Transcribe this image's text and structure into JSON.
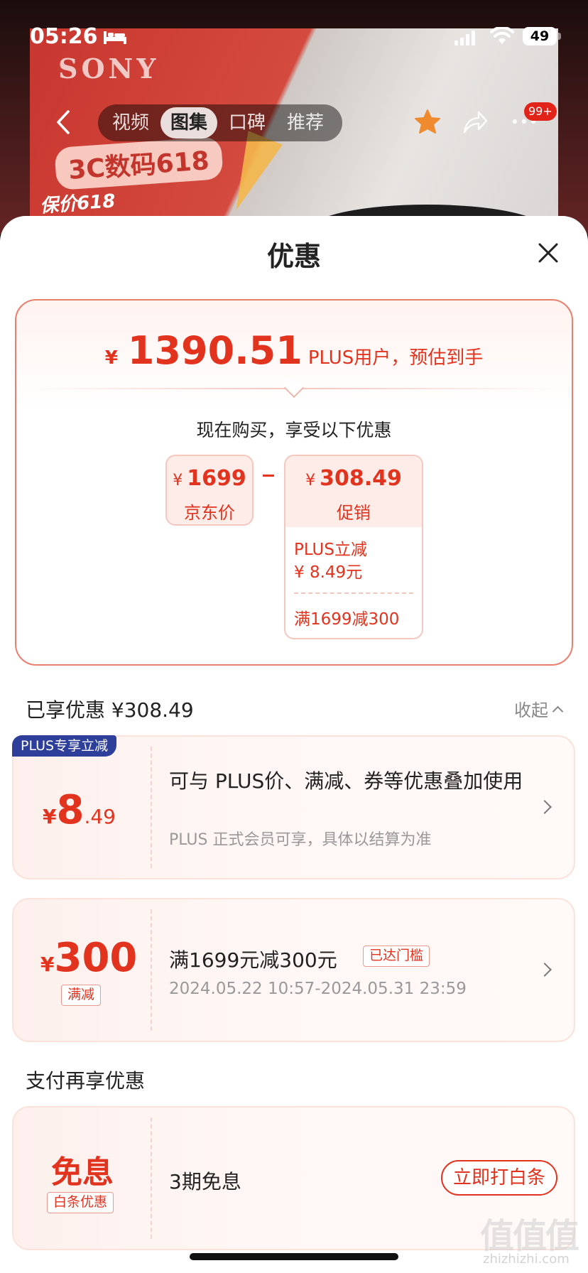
{
  "status_bar": {
    "time": "05:26",
    "battery": "49"
  },
  "background": {
    "brand": "SONY",
    "banner": "3C数码618",
    "promo_text": "保价618"
  },
  "nav": {
    "tabs": [
      {
        "label": "视频",
        "active": false
      },
      {
        "label": "图集",
        "active": true
      },
      {
        "label": "口碑",
        "active": false
      },
      {
        "label": "推荐",
        "active": false
      }
    ],
    "badge": "99+"
  },
  "sheet": {
    "title": "优惠"
  },
  "summary": {
    "currency": "¥",
    "final_price": "1390.51",
    "price_note": "PLUS用户，预估到手",
    "buy_now": "现在购买，享受以下优惠",
    "jd_price": "1699",
    "jd_label": "京东价",
    "promo_amount": "308.49",
    "promo_label": "促销",
    "promo_items": [
      "PLUS立减\n¥ 8.49元",
      "满1699减300"
    ]
  },
  "enjoyed": {
    "title": "已享优惠 ¥308.49",
    "collapse": "收起"
  },
  "deals": [
    {
      "tag": "PLUS专享立减",
      "currency": "¥",
      "amount_int": "8",
      "amount_dec": ".49",
      "title": "可与 PLUS价、满减、券等优惠叠加使用",
      "subtitle": "PLUS 正式会员可享，具体以结算为准"
    },
    {
      "currency": "¥",
      "amount_int": "300",
      "badge": "满减",
      "title": "满1699元减300元",
      "status": "已达门槛",
      "date": "2024.05.22 10:57-2024.05.31 23:59"
    }
  ],
  "payment": {
    "title": "支付再享优惠",
    "word": "免息",
    "badge": "白条优惠",
    "label": "3期免息",
    "button": "立即打白条"
  },
  "watermark": {
    "text": "值值值",
    "url": "zhizhizhi.com"
  },
  "colors": {
    "accent": "#e2331f",
    "plus_tag": "#2d3f9b",
    "card_border": "#ea7f6e"
  }
}
